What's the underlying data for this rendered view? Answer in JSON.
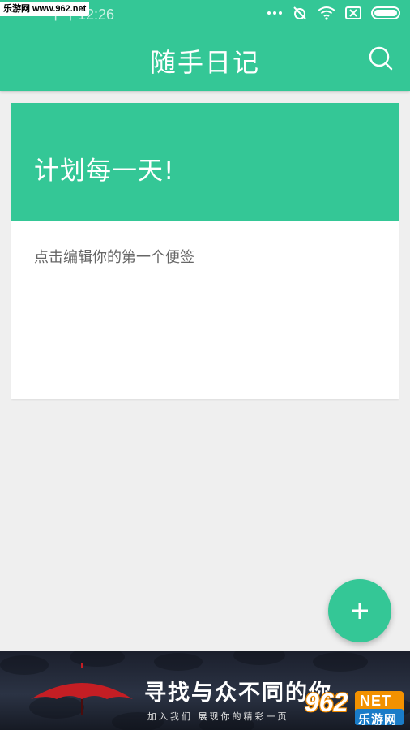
{
  "status_bar": {
    "time": "下午12:26",
    "watermark": "乐游网 www.962.net"
  },
  "app_bar": {
    "title": "随手日记",
    "search_icon": "search-icon"
  },
  "note_card": {
    "title": "计划每一天!",
    "body": "点击编辑你的第一个便签"
  },
  "fab": {
    "icon": "plus-icon"
  },
  "banner": {
    "headline": "寻找与众不同的你",
    "subline": "加入我们  展现你的精彩一页"
  },
  "logo": {
    "number": "962",
    "net": "NET",
    "name": "乐游网"
  },
  "colors": {
    "accent": "#34c796",
    "background": "#efefef",
    "card_body_text": "#666666"
  }
}
